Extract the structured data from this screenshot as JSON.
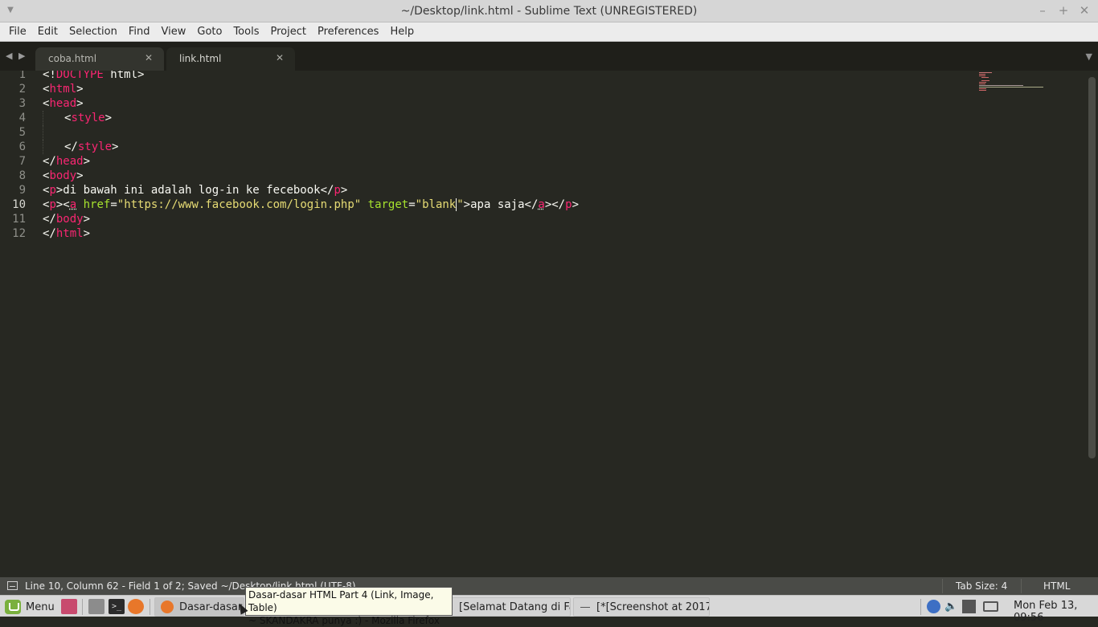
{
  "window": {
    "title": "~/Desktop/link.html - Sublime Text (UNREGISTERED)"
  },
  "menu": [
    "File",
    "Edit",
    "Selection",
    "Find",
    "View",
    "Goto",
    "Tools",
    "Project",
    "Preferences",
    "Help"
  ],
  "tabs": [
    {
      "label": "coba.html",
      "active": false
    },
    {
      "label": "link.html",
      "active": true
    }
  ],
  "editor": {
    "current_line": 10,
    "line_numbers": [
      "1",
      "2",
      "3",
      "4",
      "5",
      "6",
      "7",
      "8",
      "9",
      "10",
      "11",
      "12"
    ]
  },
  "statusbar": {
    "text": "Line 10, Column 62 - Field 1 of 2; Saved ~/Desktop/link.html (UTF-8)",
    "tab_size": "Tab Size: 4",
    "syntax": "HTML"
  },
  "taskbar": {
    "menu_label": "Menu",
    "windows": [
      {
        "label": "Dasar-dasar H",
        "icon": "firefox-icon"
      },
      {
        "label": "[Selamat Datang di Fa..."
      },
      {
        "label": "[*[Screenshot at 2017..."
      }
    ],
    "clock": "Mon Feb 13, 09:56"
  },
  "tooltip": {
    "line1": "Dasar-dasar HTML Part 4 (Link, Image, Table)",
    "line2": "~ SKANDAKRA punya :) - Mozilla Firefox"
  },
  "colors": {
    "editor_bg": "#272822",
    "tag": "#f92672",
    "attr": "#a6e22e",
    "string": "#e6db74",
    "text": "#f8f8f2"
  }
}
